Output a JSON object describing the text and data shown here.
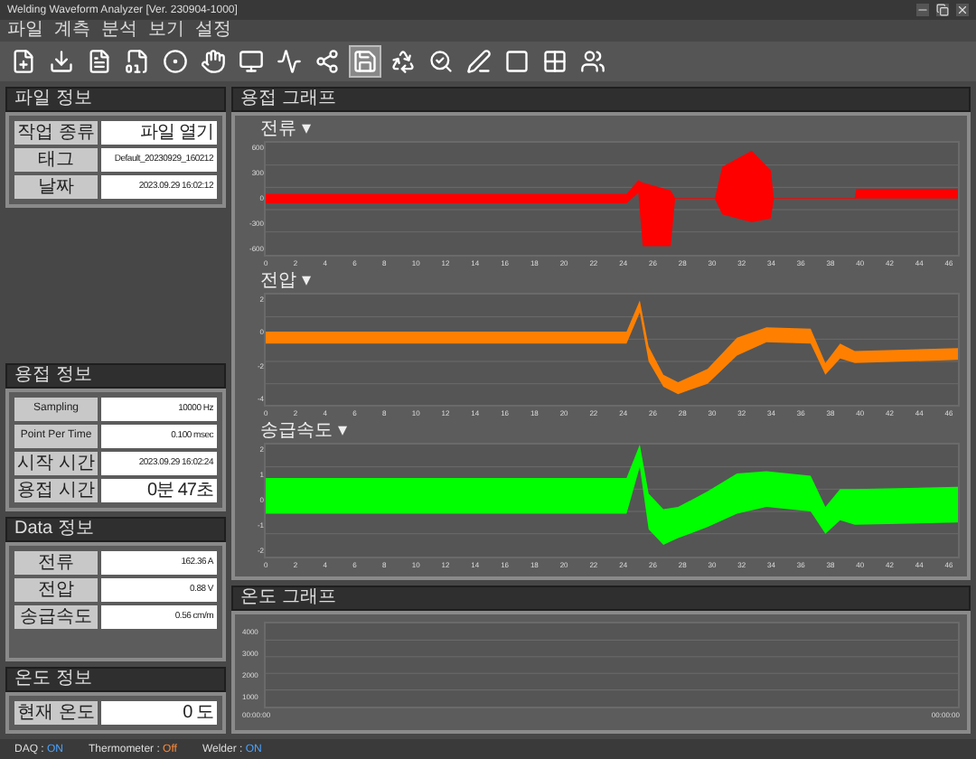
{
  "window": {
    "title": "Welding Waveform Analyzer [Ver. 230904-1000]"
  },
  "menu": [
    "파일",
    "계측",
    "분석",
    "보기",
    "설정"
  ],
  "toolbar": [
    {
      "selected": false
    },
    {
      "selected": false
    },
    {
      "selected": false
    },
    {
      "selected": false
    },
    {
      "selected": false
    },
    {
      "selected": false
    },
    {
      "selected": false
    },
    {
      "selected": false
    },
    {
      "selected": false
    },
    {
      "selected": true
    },
    {
      "selected": false
    },
    {
      "selected": false
    },
    {
      "selected": false
    },
    {
      "selected": false
    },
    {
      "selected": false
    },
    {
      "selected": false
    }
  ],
  "file_info": {
    "title": "파일 정보",
    "rows": [
      {
        "label": "작업 종류",
        "value": "파일 열기"
      },
      {
        "label": "태그",
        "value": "Default_20230929_160212"
      },
      {
        "label": "날짜",
        "value": "2023.09.29 16:02:12"
      }
    ]
  },
  "weld_info": {
    "title": "용접 정보",
    "rows": [
      {
        "label": "Sampling",
        "value": "10000 Hz"
      },
      {
        "label": "Point Per Time",
        "value": "0.100 msec"
      },
      {
        "label": "시작 시간",
        "value": "2023.09.29 16:02:24"
      },
      {
        "label": "용접 시간",
        "value": "0분 47초"
      }
    ]
  },
  "data_info": {
    "title": "Data 정보",
    "rows": [
      {
        "label": "전류",
        "value": "162.36 A"
      },
      {
        "label": "전압",
        "value": "0.88 V"
      },
      {
        "label": "송급속도",
        "value": "0.56 cm/m"
      }
    ]
  },
  "temp_info": {
    "title": "온도 정보",
    "rows": [
      {
        "label": "현재 온도",
        "value": "0 도"
      }
    ]
  },
  "weld_graph": {
    "title": "용접 그래프",
    "charts": [
      {
        "title": "전류 ▾",
        "color": "#ff0000",
        "yticks": [
          "600",
          "300",
          "0",
          "-300",
          "-600"
        ],
        "xticks": [
          "0",
          "2",
          "4",
          "6",
          "8",
          "10",
          "12",
          "14",
          "16",
          "18",
          "20",
          "22",
          "24",
          "26",
          "28",
          "30",
          "32",
          "34",
          "36",
          "38",
          "40",
          "42",
          "44",
          "46"
        ]
      },
      {
        "title": "전압 ▾",
        "color": "#ff8000",
        "yticks": [
          "2",
          "0",
          "-2",
          "-4"
        ],
        "xticks": [
          "0",
          "2",
          "4",
          "6",
          "8",
          "10",
          "12",
          "14",
          "16",
          "18",
          "20",
          "22",
          "24",
          "26",
          "28",
          "30",
          "32",
          "34",
          "36",
          "38",
          "40",
          "42",
          "44",
          "46"
        ]
      },
      {
        "title": "송급속도 ▾",
        "color": "#00ff00",
        "yticks": [
          "2",
          "1",
          "0",
          "-1",
          "-2"
        ],
        "xticks": [
          "0",
          "2",
          "4",
          "6",
          "8",
          "10",
          "12",
          "14",
          "16",
          "18",
          "20",
          "22",
          "24",
          "26",
          "28",
          "30",
          "32",
          "34",
          "36",
          "38",
          "40",
          "42",
          "44",
          "46"
        ]
      }
    ]
  },
  "temp_graph": {
    "title": "온도 그래프",
    "yticks": [
      "4000",
      "3000",
      "2000",
      "1000"
    ],
    "xstart": "00:00:00",
    "xend": "00:00:00"
  },
  "status_bar": [
    {
      "label": "DAQ : ",
      "value": "ON",
      "on": true
    },
    {
      "label": "Thermometer : ",
      "value": "Off",
      "on": false
    },
    {
      "label": "Welder : ",
      "value": "ON",
      "on": true
    }
  ]
}
